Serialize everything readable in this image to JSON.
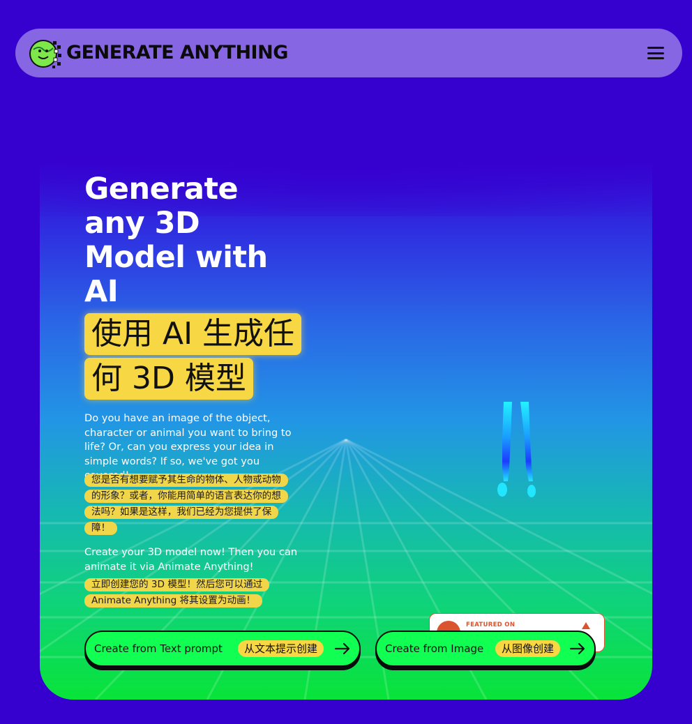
{
  "nav": {
    "brand": "GENERATE ANYTHING",
    "menu_icon": "hamburger-menu-icon",
    "logo_icon": "smiley-globe-logo-icon"
  },
  "hero": {
    "headline": "Generate any 3D Model with AI",
    "zh_title": [
      "使用 AI 生成任",
      "何 3D 模型"
    ],
    "intro": "Do you have an image of the object, character or animal you want to bring to life? Or, can you express your idea in simple words? If so, we've got you covered!",
    "intro_zh": [
      "您是否有想要赋予其生命的物体、人物或动物",
      "的形象？或者，你能用简单的语言表达你的想",
      "法吗？如果是这样，我们已经为您提供了保",
      "障！"
    ],
    "cta_text": "Create your 3D model now! Then you can animate it via Animate Anything!",
    "cta_text_zh": [
      "立即创建您的 3D 模型！然后您可以通过",
      "Animate Anything 将其设置为动画！"
    ]
  },
  "badge": {
    "text": "FEATURED ON",
    "color": "#da552f"
  },
  "buttons": [
    {
      "label": "Create from Text prompt",
      "label_zh": "从文本提示创建",
      "icon": "arrow-right-icon"
    },
    {
      "label": "Create from Image",
      "label_zh": "从图像创建",
      "icon": "arrow-right-icon"
    }
  ],
  "colors": {
    "background": "#3600cf",
    "navbar": "#8666e3",
    "highlight": "#f7d744",
    "button": "#10ff52"
  }
}
